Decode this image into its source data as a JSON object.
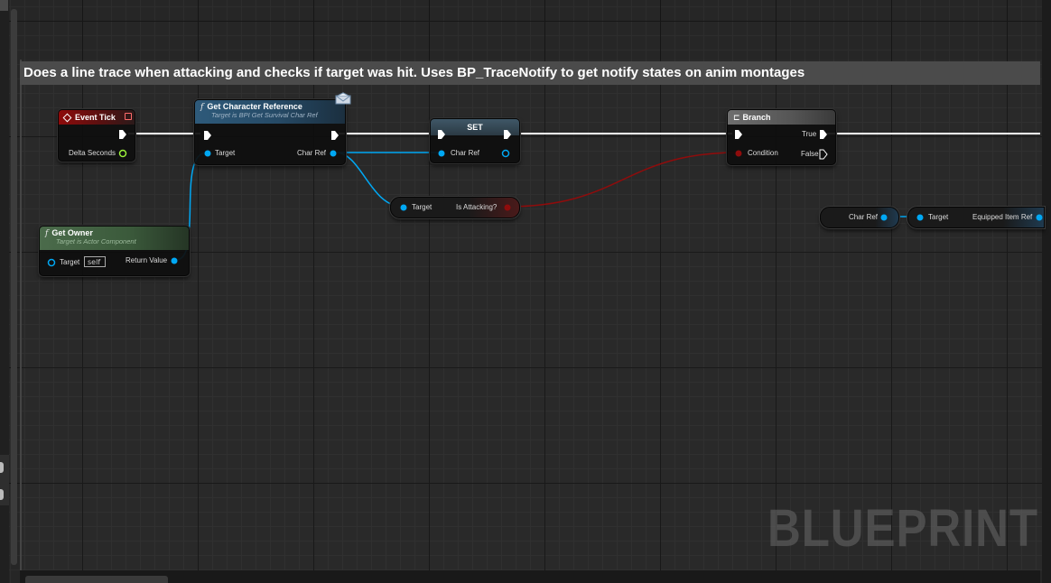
{
  "comment": {
    "title": "Does a line trace when attacking and checks if target was hit. Uses BP_TraceNotify to get notify states on anim montages"
  },
  "nodes": {
    "event_tick": {
      "title": "Event Tick",
      "pin_delta": "Delta Seconds",
      "icon": "event-diamond-icon"
    },
    "get_char_ref": {
      "title": "Get Character Reference",
      "subtitle": "Target is BPI Get Survival Char Ref",
      "pin_target": "Target",
      "pin_out": "Char Ref",
      "icon": "function-icon"
    },
    "set": {
      "title": "SET",
      "pin_char_ref": "Char Ref"
    },
    "branch": {
      "title": "Branch",
      "pin_condition": "Condition",
      "pin_true": "True",
      "pin_false": "False",
      "icon": "branch-icon"
    },
    "get_owner": {
      "title": "Get Owner",
      "subtitle": "Target is Actor Component",
      "pin_target": "Target",
      "target_default": "self",
      "pin_return": "Return Value",
      "icon": "function-icon"
    },
    "is_attacking": {
      "pin_target": "Target",
      "pin_out": "Is Attacking?"
    },
    "char_ref_getter": {
      "pin_out": "Char Ref"
    },
    "equipped_item": {
      "pin_target": "Target",
      "pin_out": "Equipped Item Ref"
    }
  },
  "watermark": "BLUEPRINT",
  "colors": {
    "exec": "#ffffff",
    "object_pin": "#00a8f4",
    "bool_pin": "#8f0c0c",
    "event_header": "#8e0b0b",
    "function_header": "#2e5a7a",
    "pure_header": "#4b6b4b"
  }
}
